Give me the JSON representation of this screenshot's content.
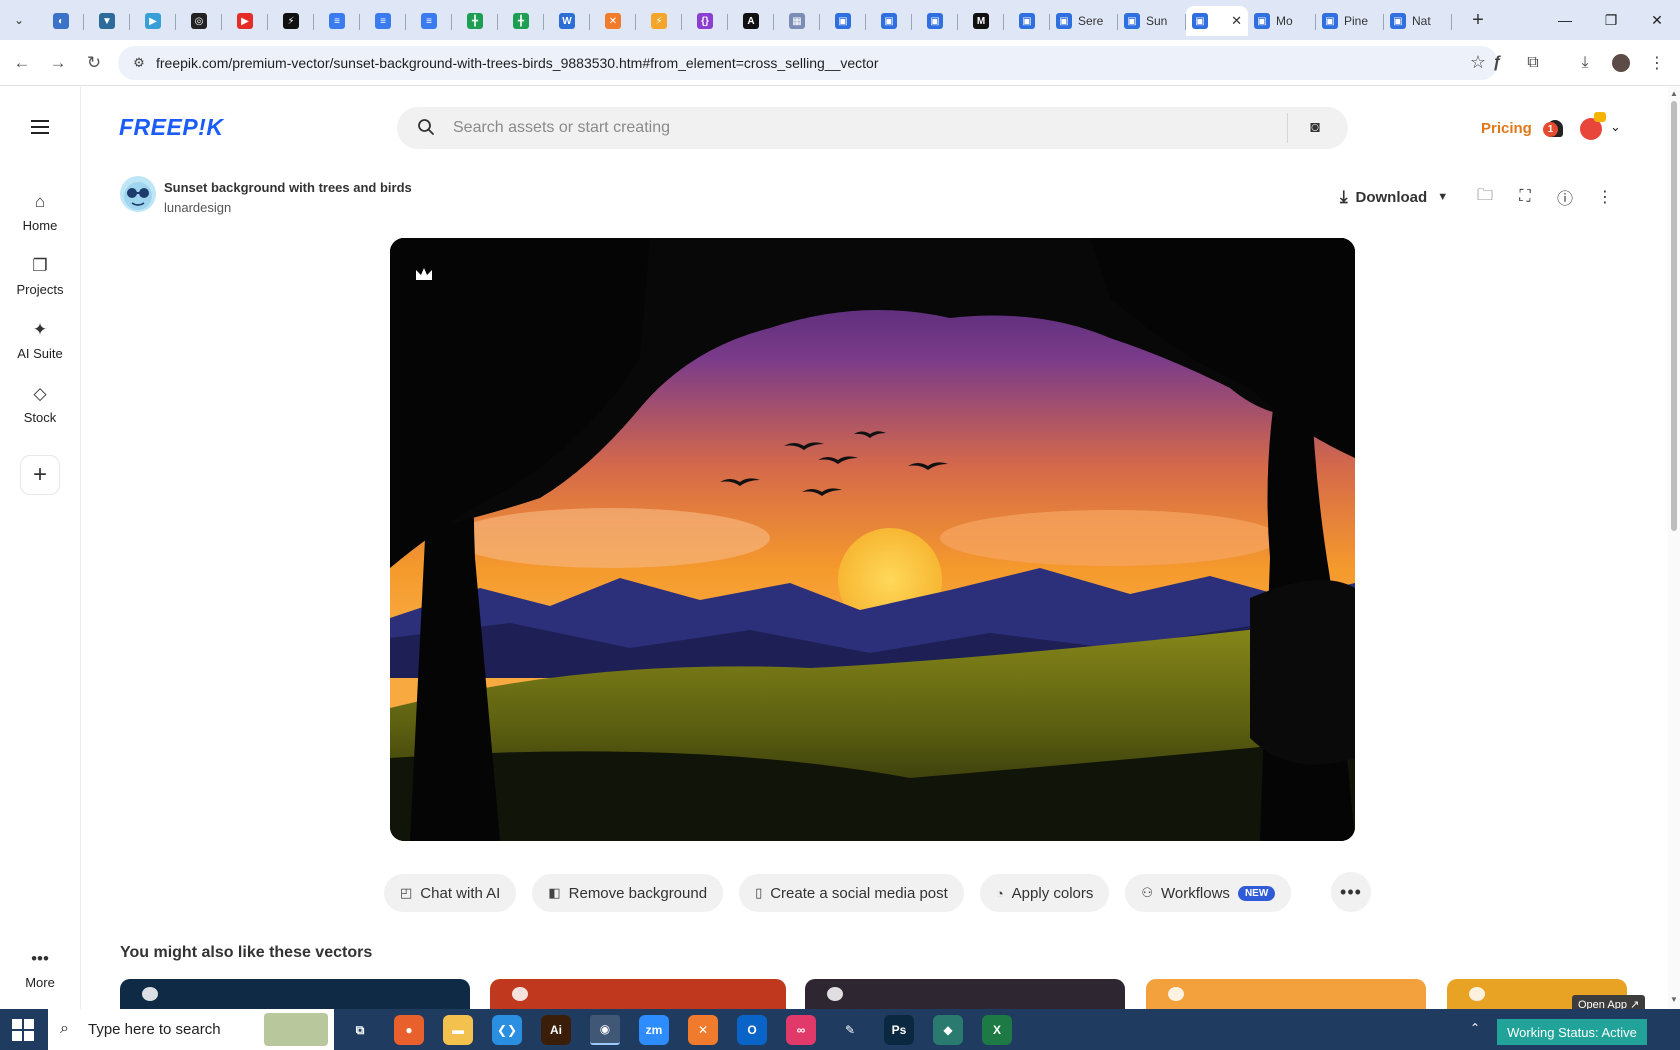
{
  "browser": {
    "tabs": [
      {
        "kind": "pinned",
        "icon": "globe-icon",
        "color": "#3b73c9",
        "glyph": "◐"
      },
      {
        "kind": "pinned",
        "icon": "vpn-icon",
        "color": "#2d6b9a",
        "glyph": "▼"
      },
      {
        "kind": "pinned",
        "icon": "hex-icon",
        "color": "#38a0d6",
        "glyph": "▶"
      },
      {
        "kind": "pinned",
        "icon": "openai-icon",
        "color": "#222222",
        "glyph": "◎"
      },
      {
        "kind": "pinned",
        "icon": "youtube-icon",
        "color": "#e52d27",
        "glyph": "▶"
      },
      {
        "kind": "pinned",
        "icon": "bolt-icon",
        "color": "#111111",
        "glyph": "⚡"
      },
      {
        "kind": "pinned",
        "icon": "docs-icon",
        "color": "#3a7cf0",
        "glyph": "≡"
      },
      {
        "kind": "pinned",
        "icon": "docs-icon",
        "color": "#3a7cf0",
        "glyph": "≡"
      },
      {
        "kind": "pinned",
        "icon": "docs-icon",
        "color": "#3a7cf0",
        "glyph": "≡"
      },
      {
        "kind": "pinned",
        "icon": "sheets-icon",
        "color": "#1e9e52",
        "glyph": "╋"
      },
      {
        "kind": "pinned",
        "icon": "sheets-icon",
        "color": "#1e9e52",
        "glyph": "╋"
      },
      {
        "kind": "pinned",
        "icon": "word-icon",
        "color": "#2b6fd6",
        "glyph": "W"
      },
      {
        "kind": "pinned",
        "icon": "xampp-icon",
        "color": "#f07b2c",
        "glyph": "✕"
      },
      {
        "kind": "pinned",
        "icon": "vite-icon",
        "color": "#f4a52a",
        "glyph": "⚡"
      },
      {
        "kind": "pinned",
        "icon": "json-icon",
        "color": "#8a3fd1",
        "glyph": "{}"
      },
      {
        "kind": "pinned",
        "icon": "a-icon",
        "color": "#111111",
        "glyph": "A"
      },
      {
        "kind": "pinned",
        "icon": "grid-icon",
        "color": "#7c8db5",
        "glyph": "▦"
      },
      {
        "kind": "pinned",
        "icon": "forms-icon",
        "color": "#2f6fe0",
        "glyph": "▣"
      },
      {
        "kind": "pinned",
        "icon": "forms-icon",
        "color": "#2f6fe0",
        "glyph": "▣"
      },
      {
        "kind": "pinned",
        "icon": "forms-icon",
        "color": "#2f6fe0",
        "glyph": "▣"
      },
      {
        "kind": "pinned",
        "icon": "medium-icon",
        "color": "#111111",
        "glyph": "M"
      },
      {
        "kind": "pinned",
        "icon": "forms-icon",
        "color": "#2f6fe0",
        "glyph": "▣"
      },
      {
        "kind": "titled",
        "icon": "forms-icon",
        "color": "#2f6fe0",
        "glyph": "▣",
        "title": "Sere"
      },
      {
        "kind": "titled",
        "icon": "forms-icon",
        "color": "#2f6fe0",
        "glyph": "▣",
        "title": "Sun"
      },
      {
        "kind": "active",
        "icon": "forms-icon",
        "color": "#2f6fe0",
        "glyph": "▣"
      },
      {
        "kind": "titled",
        "icon": "forms-icon",
        "color": "#2f6fe0",
        "glyph": "▣",
        "title": "Mo"
      },
      {
        "kind": "titled",
        "icon": "forms-icon",
        "color": "#2f6fe0",
        "glyph": "▣",
        "title": "Pine"
      },
      {
        "kind": "titled",
        "icon": "forms-icon",
        "color": "#2f6fe0",
        "glyph": "▣",
        "title": "Nat"
      }
    ],
    "url_host": "freepik.com",
    "url_path": "/premium-vector/sunset-background-with-trees-birds_9883530.htm#from_element=cross_selling__vector"
  },
  "app": {
    "logo": "FREEP!K",
    "search_placeholder": "Search assets or start creating",
    "pricing": "Pricing",
    "notification_count": "1",
    "nav": [
      {
        "label": "Home",
        "icon": "home-icon",
        "glyph": "⌂"
      },
      {
        "label": "Projects",
        "icon": "projects-icon",
        "glyph": "❐"
      },
      {
        "label": "AI Suite",
        "icon": "sparkle-icon",
        "glyph": "✦"
      },
      {
        "label": "Stock",
        "icon": "shapes-icon",
        "glyph": "◇"
      }
    ],
    "more_label": "More",
    "more_glyph": "•••"
  },
  "resource": {
    "title": "Sunset background with trees and birds",
    "author": "lunardesign",
    "download_label": "Download"
  },
  "actions": [
    {
      "label": "Chat with AI",
      "icon": "chat-icon",
      "glyph": "◰"
    },
    {
      "label": "Remove background",
      "icon": "remove-bg-icon",
      "glyph": "◧"
    },
    {
      "label": "Create a social media post",
      "icon": "phone-icon",
      "glyph": "▯"
    },
    {
      "label": "Apply colors",
      "icon": "palette-icon",
      "glyph": "◔"
    },
    {
      "label": "Workflows",
      "icon": "workflow-icon",
      "glyph": "⚇",
      "badge": "NEW"
    }
  ],
  "related": {
    "heading": "You might also like these vectors",
    "cards": [
      {
        "color": "#0f2a45"
      },
      {
        "color": "#c0391f"
      },
      {
        "color": "#2e2630"
      },
      {
        "color": "#f2a13c"
      },
      {
        "color": "#e8a224"
      }
    ]
  },
  "open_app": "Open App ↗",
  "taskbar": {
    "search_placeholder": "Type here to search",
    "apps": [
      {
        "icon": "task-view-icon",
        "color": "#1f3b5f",
        "glyph": "⧉"
      },
      {
        "icon": "firefox-icon",
        "color": "#e8602c",
        "glyph": "●"
      },
      {
        "icon": "file-explorer-icon",
        "color": "#f2c14e",
        "glyph": "▬"
      },
      {
        "icon": "vscode-icon",
        "color": "#2a8fe0",
        "glyph": "❮❯"
      },
      {
        "icon": "illustrator-icon",
        "color": "#3a1e0a",
        "glyph": "Ai"
      },
      {
        "icon": "chrome-icon",
        "color": "#3c8a3f",
        "glyph": "◉"
      },
      {
        "icon": "zoom-icon",
        "color": "#2d8cff",
        "glyph": "zm"
      },
      {
        "icon": "xampp-icon",
        "color": "#f07b2c",
        "glyph": "✕"
      },
      {
        "icon": "outlook-icon",
        "color": "#0a64c8",
        "glyph": "O"
      },
      {
        "icon": "creative-cloud-icon",
        "color": "#e2396b",
        "glyph": "∞"
      },
      {
        "icon": "pen-icon",
        "color": "#1f3b5f",
        "glyph": "✎"
      },
      {
        "icon": "photoshop-icon",
        "color": "#0b2841",
        "glyph": "Ps"
      },
      {
        "icon": "app-icon",
        "color": "#2a7a6f",
        "glyph": "◆"
      },
      {
        "icon": "excel-icon",
        "color": "#1d7a44",
        "glyph": "X"
      }
    ],
    "working_status": "Working Status: Active"
  }
}
